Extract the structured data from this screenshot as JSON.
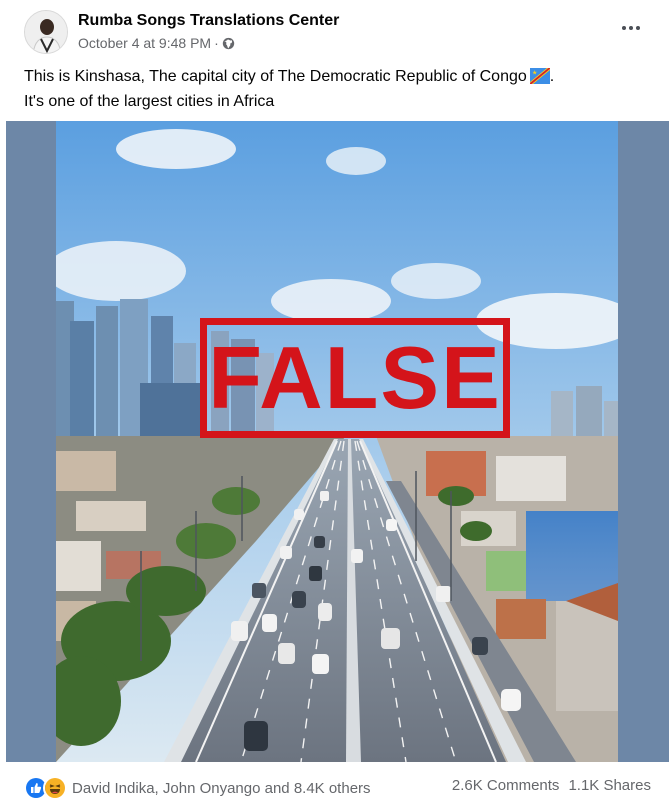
{
  "post": {
    "author": "Rumba Songs Translations Center",
    "timestamp": "October 4 at 9:48 PM",
    "separator": "·",
    "audience_icon": "globe-icon",
    "caption_line1": "This is Kinshasa, The capital city of The Democratic Republic of Congo",
    "caption_flag": "dr-congo-flag-emoji",
    "caption_line1_end": ".",
    "caption_line2": "It's one of the largest cities in Africa"
  },
  "media": {
    "stamp_text": "FALSE",
    "stamp_color": "#d4141a",
    "frame_color": "#6d87a7"
  },
  "footer": {
    "reaction_icons": [
      "like-icon",
      "haha-icon"
    ],
    "reaction_names": "David Indika, John Onyango and 8.4K others",
    "comments": "2.6K Comments",
    "shares": "1.1K Shares"
  }
}
